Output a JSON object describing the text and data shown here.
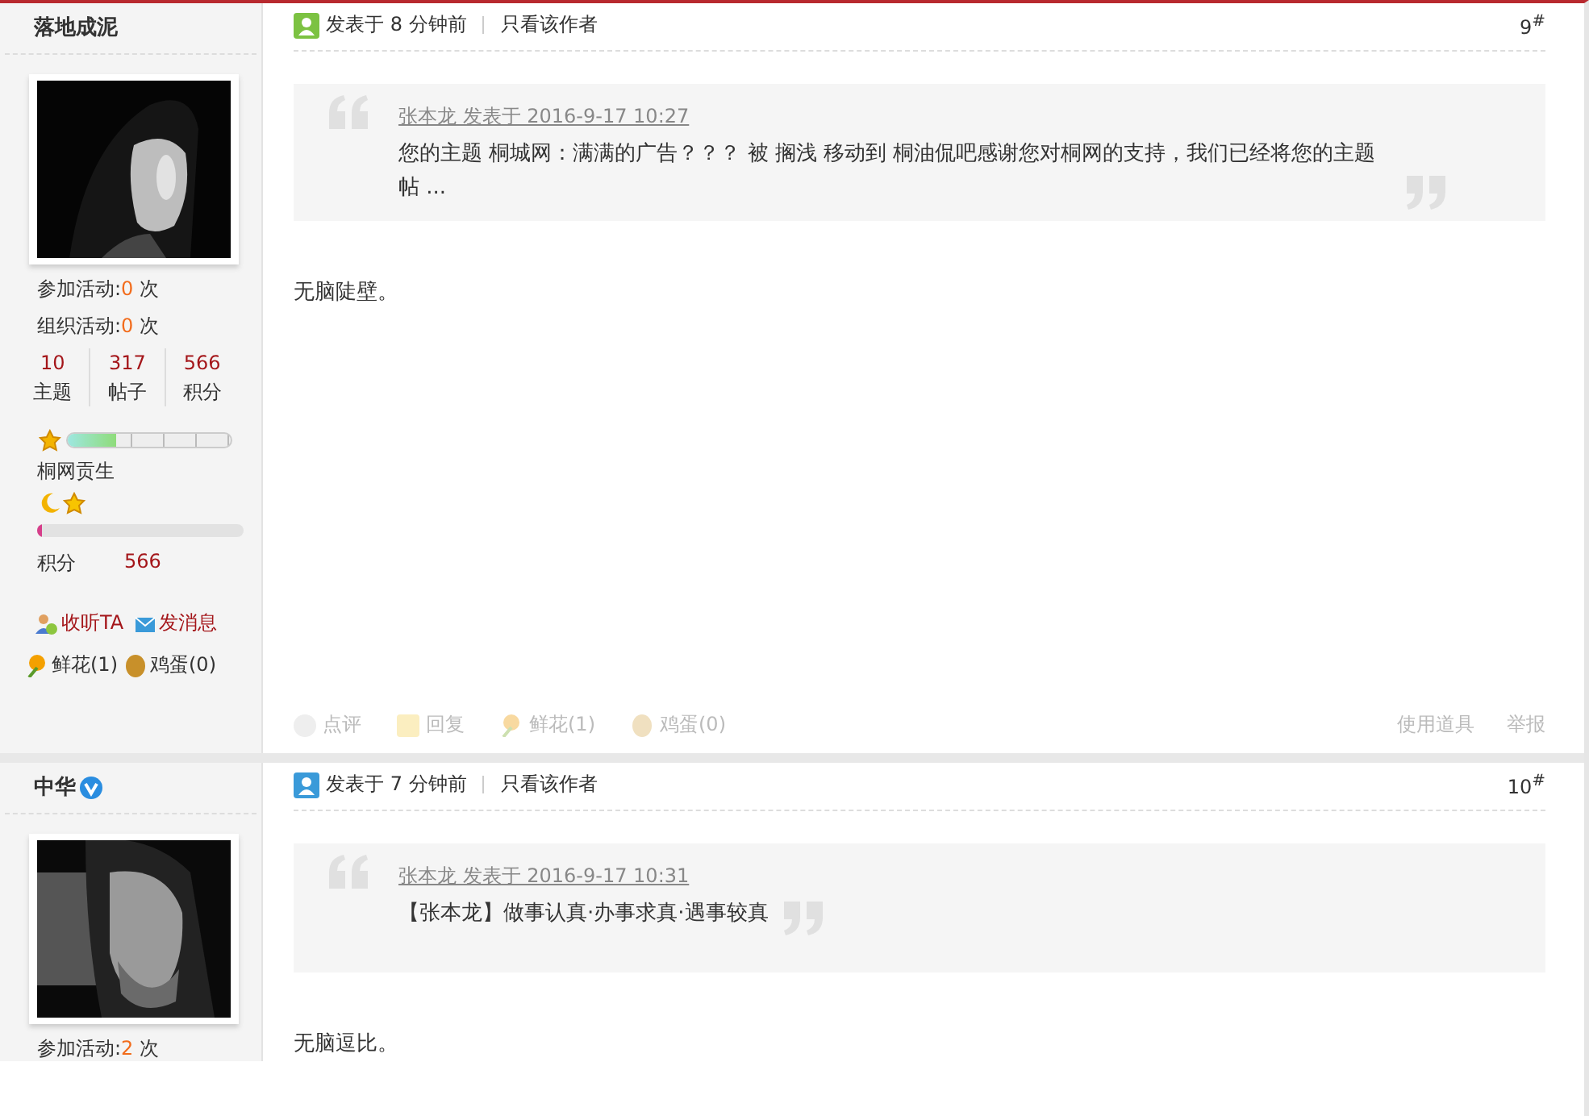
{
  "posts": [
    {
      "author": "落地成泥",
      "verified": false,
      "avatar": {
        "kind": "picture"
      },
      "stats": [
        {
          "label": "参加活动:",
          "value": "0",
          "unit": "次"
        },
        {
          "label": "组织活动:",
          "value": "0",
          "unit": "次"
        }
      ],
      "counts": [
        {
          "value": "10",
          "label": "主题"
        },
        {
          "value": "317",
          "label": "帖子"
        },
        {
          "value": "566",
          "label": "积分"
        }
      ],
      "level": 0.3,
      "rank": "桐网贡生",
      "points": {
        "level": 0.02,
        "label": "积分",
        "value": "566"
      },
      "actions": [
        "收听TA",
        "发消息"
      ],
      "gifts": [
        "鲜花(1)",
        "鸡蛋(0)"
      ],
      "color": "#7cc242",
      "time": "发表于 8 分钟前",
      "only_author": "只看该作者",
      "floor": "9$^{#}$",
      "quote": {
        "meta": "张本龙 发表于 2016-9-17 10:27",
        "text": "您的主题 桐城网：满满的广告？？？ 被 搁浅 移动到 桐油侃吧感谢您对桐网的支持，我们已经将您的主题帖 ..."
      },
      "body": "无脑陡壁。",
      "footer": {
        "left": [
          "点评",
          "回复",
          "鲜花(1)",
          "鸡蛋(0)"
        ],
        "right": [
          "使用道具",
          "举报"
        ]
      }
    },
    {
      "author": "中华",
      "verified": true,
      "avatar": {
        "kind": "picture"
      },
      "stats": [
        {
          "label": "参加活动:",
          "value": "2",
          "unit": "次"
        }
      ],
      "color": "#3a9ad9",
      "time": "发表于 7 分钟前",
      "only_author": "只看该作者",
      "floor": "10$^{#}$",
      "quote": {
        "meta": "张本龙 发表于 2016-9-17 10:31",
        "text": "【张本龙】做事认真·办事求真·遇事较真"
      },
      "body": "无脑逗比。"
    }
  ]
}
